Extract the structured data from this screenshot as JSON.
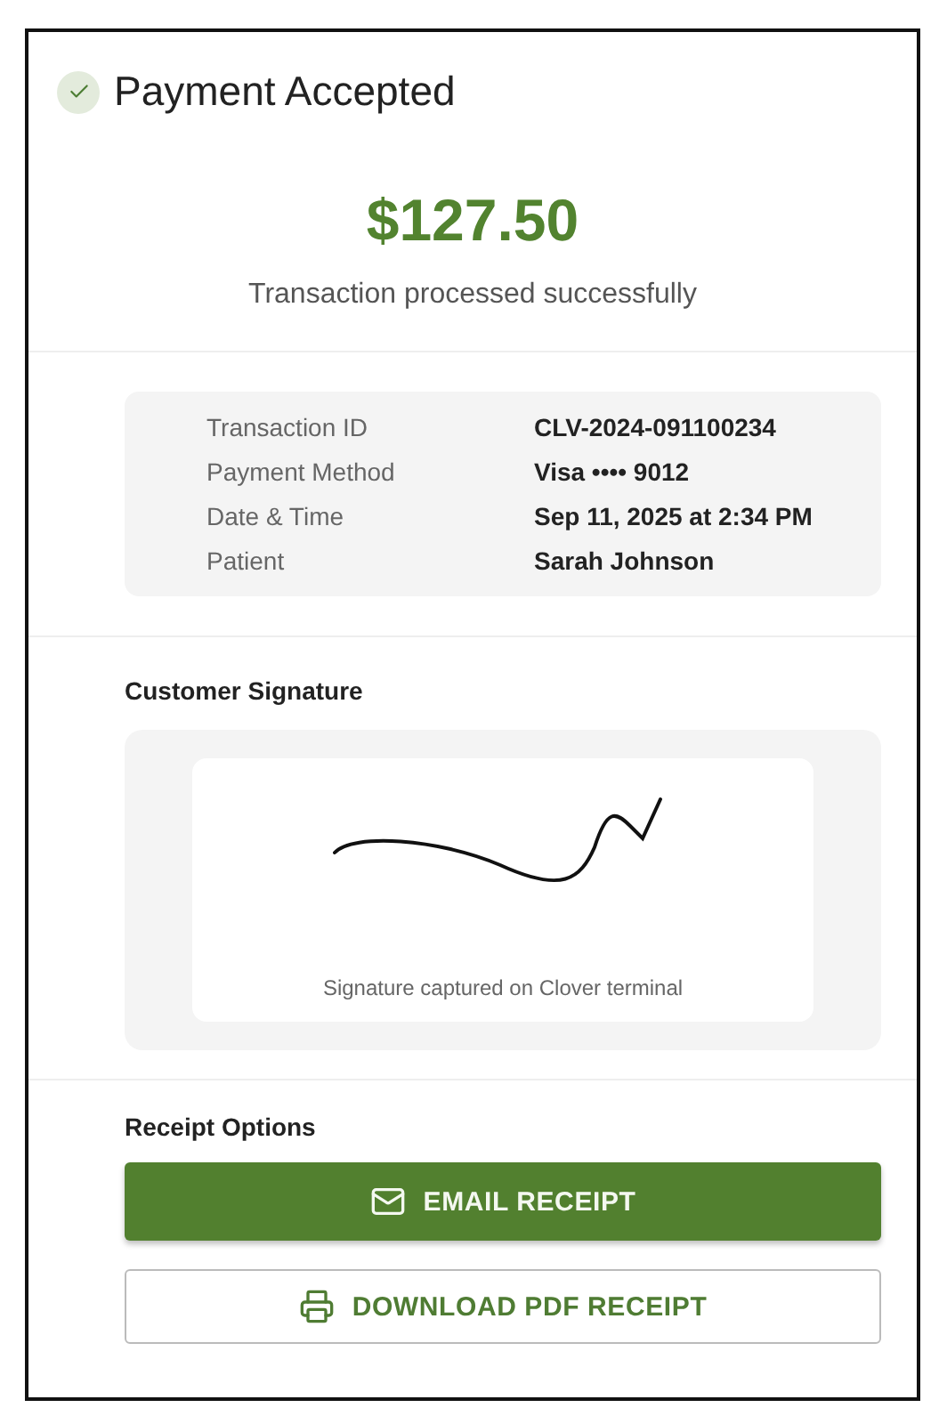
{
  "header": {
    "title": "Payment Accepted"
  },
  "summary": {
    "amount": "$127.50",
    "message": "Transaction processed successfully"
  },
  "details": [
    {
      "label": "Transaction ID",
      "value": "CLV-2024-091100234"
    },
    {
      "label": "Payment Method",
      "value": "Visa •••• 9012"
    },
    {
      "label": "Date & Time",
      "value": "Sep 11, 2025 at 2:34 PM"
    },
    {
      "label": "Patient",
      "value": "Sarah Johnson"
    }
  ],
  "signature": {
    "heading": "Customer Signature",
    "caption": "Signature captured on Clover terminal"
  },
  "receipt_options": {
    "heading": "Receipt Options",
    "buttons": [
      {
        "label": "EMAIL RECEIPT",
        "kind": "primary"
      },
      {
        "label": "DOWNLOAD PDF RECEIPT",
        "kind": "outlined"
      }
    ]
  }
}
